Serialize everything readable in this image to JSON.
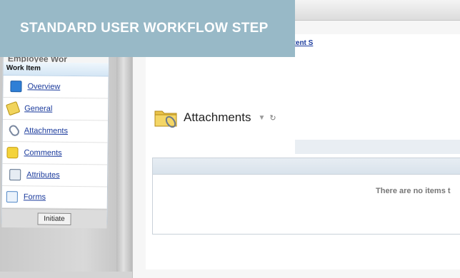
{
  "banner": {
    "title": "STANDARD USER WORKFLOW STEP"
  },
  "sidebar": {
    "header": "Employee Wor",
    "section": "Work Item",
    "items": [
      {
        "label": "Overview",
        "icon": "overview-icon",
        "color": "#2f7fd6"
      },
      {
        "label": "General",
        "icon": "pencil-icon",
        "color": "#d7b21f"
      },
      {
        "label": "Attachments",
        "icon": "paperclip-icon",
        "color": "#7a88a0"
      },
      {
        "label": "Comments",
        "icon": "comment-icon",
        "color": "#e8c11d"
      },
      {
        "label": "Attributes",
        "icon": "attributes-icon",
        "color": "#5a6f8a"
      },
      {
        "label": "Forms",
        "icon": "form-icon",
        "color": "#4f86c6"
      }
    ],
    "initiate_label": "Initiate"
  },
  "main": {
    "copy_link": "Copy item from Content S",
    "section_title": "Attachments",
    "empty_message": "There are no items t"
  }
}
